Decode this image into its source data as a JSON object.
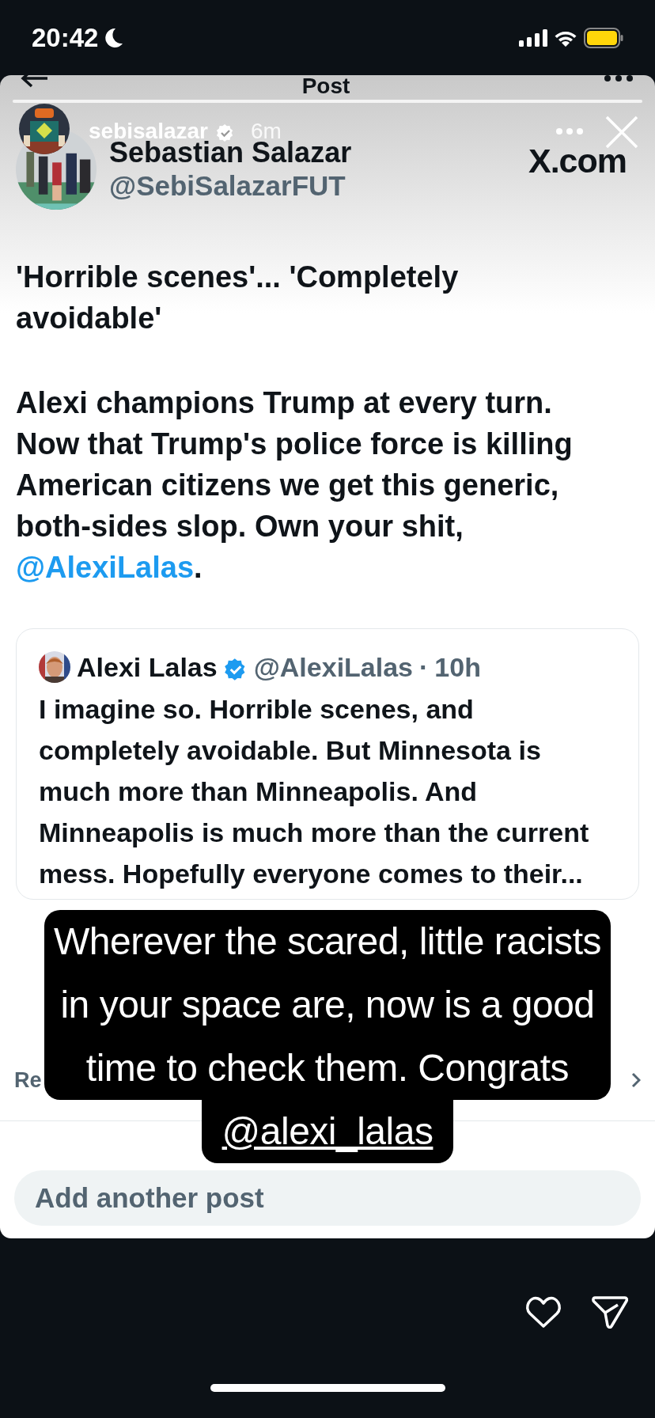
{
  "status_bar": {
    "time": "20:42"
  },
  "story": {
    "progress": {
      "level": 1
    },
    "username": "sebisalazar",
    "verified": true,
    "time": "6m"
  },
  "x_post": {
    "header_title": "Post",
    "author_name": "Sebastian Salazar",
    "author_handle": "@SebiSalazarFUT",
    "site_logo": "X.com",
    "paragraphs": [
      {
        "text": "'Horrible scenes'... 'Completely avoidable'"
      },
      {
        "text": "Alexi champions Trump at every turn. Now that Trump's police force is killing American citizens we get this generic, both-sides slop. Own your shit, ",
        "mention": "@AlexiLalas",
        "after": "."
      }
    ],
    "quoted_post": {
      "name": "Alexi Lalas",
      "verified": true,
      "handle": "@AlexiLalas",
      "separator": "·",
      "time": "10h",
      "text": "I imagine so. Horrible scenes, and completely avoidable. But Minnesota is much more than Minneapolis. And Minneapolis is much more than the current mess. Hopefully everyone comes to their..."
    },
    "replies_label": "Re",
    "compose_placeholder": "Add another post"
  },
  "caption": {
    "text": "Wherever the scared, little racists in your space are, now is a good time to check them. Congrats ",
    "mention": "@alexi_lalas"
  }
}
